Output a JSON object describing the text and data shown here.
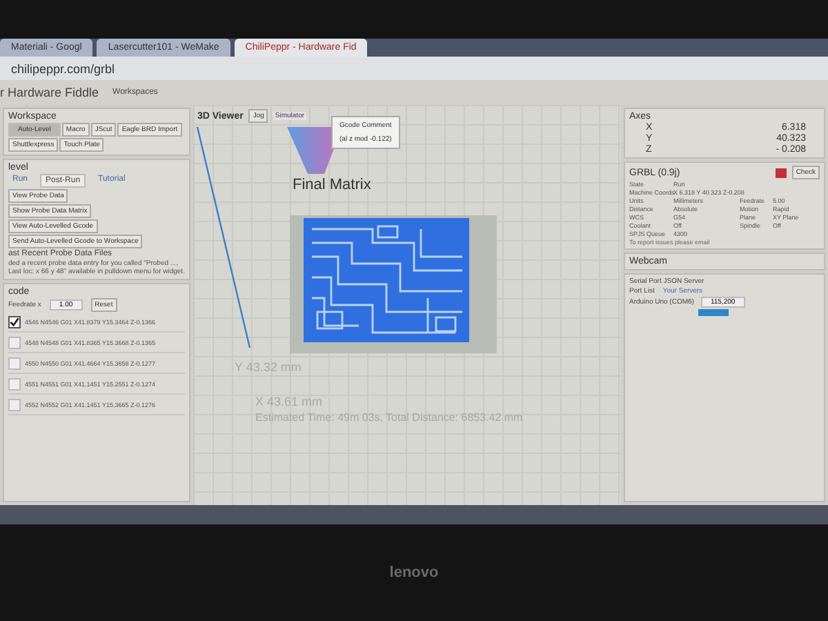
{
  "browser": {
    "tabs": [
      {
        "title": "Materiali - Googl",
        "selected": false
      },
      {
        "title": "Lasercutter101 - WeMake",
        "selected": false
      },
      {
        "title": "ChiliPeppr - Hardware Fid",
        "selected": true
      }
    ],
    "url": "chilipeppr.com/grbl"
  },
  "app": {
    "title": "r Hardware Fiddle",
    "menu": "Workspaces"
  },
  "workspace": {
    "title": "Workspace",
    "buttons": [
      {
        "label": "Auto-Level",
        "selected": true
      },
      {
        "label": "Macro",
        "selected": false
      },
      {
        "label": "JScut",
        "selected": false
      },
      {
        "label": "Eagle BRD Import",
        "selected": false
      },
      {
        "label": "Shuttlexpress",
        "selected": false
      },
      {
        "label": "Touch Plate",
        "selected": false
      }
    ]
  },
  "autolevel": {
    "title": "level",
    "tabs": [
      {
        "label": "Run",
        "selected": false
      },
      {
        "label": "Post-Run",
        "selected": true
      },
      {
        "label": "Tutorial",
        "selected": false
      }
    ],
    "actions": [
      "View Probe Data",
      "Show Probe Data Matrix",
      "View Auto-Levelled Gcode",
      "Send Auto-Levelled Gcode to Workspace"
    ],
    "heading": "ast Recent Probe Data Files",
    "note": "ded a recent probe data entry for you called \"Probed ..., Last loc: x 66 y 48\" available in pulldown menu for widget."
  },
  "gcode": {
    "title": "code",
    "feedrate_label": "Feedrate x",
    "feedrate": "1.00",
    "reset": "Reset",
    "lines": [
      {
        "text": "4546  N4546 G01 X41.8379 Y15.3464 Z-0.1366",
        "checked": true
      },
      {
        "text": "4548  N4548 G01 X41.8365 Y15.3668 Z-0.1365",
        "checked": false
      },
      {
        "text": "4550  N4550 G01 X41.4664 Y15.3658 Z-0.1277",
        "checked": false
      },
      {
        "text": "4551  N4551 G01 X41.1451 Y15.2551 Z-0.1274",
        "checked": false
      },
      {
        "text": "4552  N4552 G01 X41.1451 Y15.3665 Z-0.1276",
        "checked": false
      }
    ]
  },
  "viewer": {
    "title": "3D Viewer",
    "jog": "Jog",
    "simulator": "Simulator",
    "tooltip": {
      "title": "Gcode Comment",
      "text": "(al z mod -0.122)"
    },
    "label": "Final Matrix",
    "y_dim": "Y 43.32 mm",
    "x_dim": "X 43.61 mm",
    "estimate": "Estimated Time: 49m 03s, Total Distance: 6853.42 mm"
  },
  "axes": {
    "title": "Axes",
    "rows": [
      {
        "axis": "X",
        "value": "6.318"
      },
      {
        "axis": "Y",
        "value": "40.323"
      },
      {
        "axis": "Z",
        "value": "- 0.208"
      }
    ]
  },
  "grbl": {
    "title": "GRBL (0.9j)",
    "check": "Check",
    "rows": [
      [
        "State",
        "Run",
        "",
        ""
      ],
      [
        "Machine Coords",
        "X 6.318 Y 40.323 Z-0.208",
        "",
        ""
      ],
      [
        "Units",
        "Millimeters",
        "Feedrate",
        "5.00"
      ],
      [
        "Distance",
        "Absolute",
        "Motion",
        "Rapid"
      ],
      [
        "WCS",
        "G54",
        "Plane",
        "XY Plane"
      ],
      [
        "Coolant",
        "Off",
        "Spindle",
        "Off"
      ],
      [
        "SPJS Queue",
        "4300",
        "",
        ""
      ]
    ],
    "footer": "To report issues please email"
  },
  "webcam": {
    "title": "Webcam"
  },
  "serial": {
    "title": "Serial Port JSON Server",
    "tabs": [
      {
        "label": "Port List",
        "selected": true
      },
      {
        "label": "Your Servers",
        "selected": false
      }
    ],
    "port": "Arduino Uno (COM6)",
    "baud": "115,200"
  },
  "bezel": {
    "logo": "lenovo"
  }
}
